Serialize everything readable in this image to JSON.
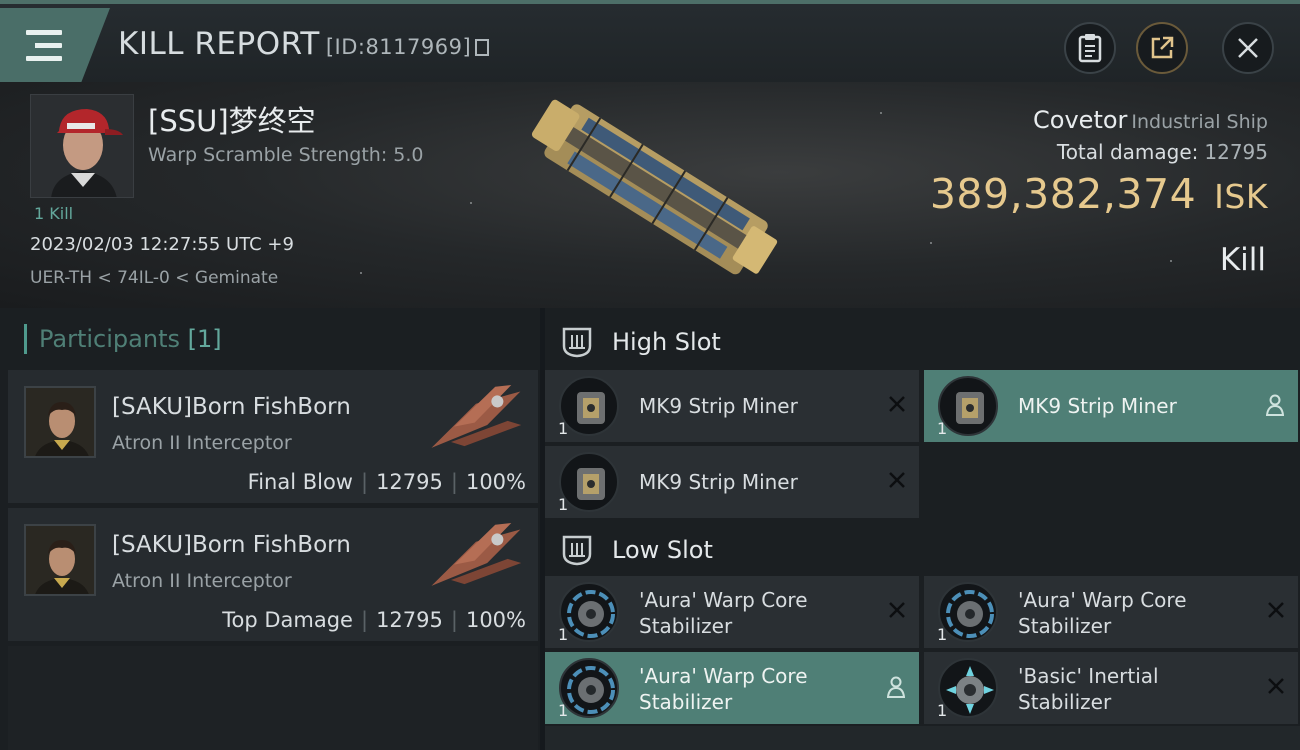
{
  "header": {
    "title": "KILL REPORT",
    "report_id": "[ID:8117969]"
  },
  "victim": {
    "name": "[SSU]梦终空",
    "warp_scramble": "Warp Scramble Strength: 5.0",
    "kills": "1 Kill",
    "datetime": "2023/02/03 12:27:55 UTC +9",
    "location": "UER-TH < 74IL-0 < Geminate",
    "ship_name": "Covetor",
    "ship_class": "Industrial Ship",
    "total_damage_label": "Total damage:",
    "total_damage": "12795",
    "isk_value": "389,382,374",
    "isk_currency": "ISK",
    "result": "Kill"
  },
  "participants": {
    "title": "Participants",
    "count": "[1]",
    "items": [
      {
        "name": "[SAKU]Born FishBorn",
        "ship": "Atron II Interceptor",
        "role": "Final Blow",
        "damage": "12795",
        "percent": "100%"
      },
      {
        "name": "[SAKU]Born FishBorn",
        "ship": "Atron II Interceptor",
        "role": "Top Damage",
        "damage": "12795",
        "percent": "100%"
      }
    ]
  },
  "fitting": {
    "high_slot": {
      "title": "High Slot",
      "modules": [
        {
          "name_line1": "MK9 Strip Miner",
          "name_line2": "",
          "qty": "1",
          "selected": false
        },
        {
          "name_line1": "MK9 Strip Miner",
          "name_line2": "",
          "qty": "1",
          "selected": true
        },
        {
          "name_line1": "MK9 Strip Miner",
          "name_line2": "",
          "qty": "1",
          "selected": false
        }
      ]
    },
    "low_slot": {
      "title": "Low Slot",
      "modules": [
        {
          "name_line1": "'Aura' Warp Core",
          "name_line2": "Stabilizer",
          "qty": "1",
          "selected": false
        },
        {
          "name_line1": "'Aura' Warp Core",
          "name_line2": "Stabilizer",
          "qty": "1",
          "selected": false
        },
        {
          "name_line1": "'Aura' Warp Core",
          "name_line2": "Stabilizer",
          "qty": "1",
          "selected": true
        },
        {
          "name_line1": "'Basic' Inertial",
          "name_line2": "Stabilizer",
          "qty": "1",
          "selected": false
        }
      ]
    }
  },
  "colors": {
    "accent_teal": "#4f7f76",
    "isk_gold": "#e6c98e",
    "panel_dark": "#1b1f22",
    "card": "#2a2f33"
  },
  "icons": [
    "menu-icon",
    "copy-icon",
    "clipboard-icon",
    "share-icon",
    "close-icon",
    "high-slot-icon",
    "low-slot-icon",
    "remove-icon",
    "person-icon"
  ]
}
